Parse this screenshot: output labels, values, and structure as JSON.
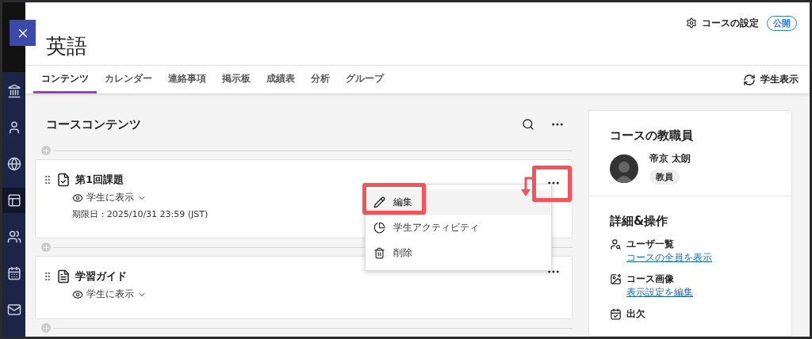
{
  "sidebar": {
    "items": [
      {
        "kind": "institution",
        "selected": false
      },
      {
        "kind": "profile",
        "selected": false
      },
      {
        "kind": "globe",
        "selected": false
      },
      {
        "kind": "courses",
        "selected": true
      },
      {
        "kind": "groups",
        "selected": false
      },
      {
        "kind": "calendar",
        "selected": false
      },
      {
        "kind": "messages",
        "selected": false
      }
    ]
  },
  "course": {
    "title": "英語",
    "settings": "コースの設定",
    "status_badge": "公開"
  },
  "tabs": [
    {
      "label": "コンテンツ",
      "selected": true
    },
    {
      "label": "カレンダー",
      "selected": false
    },
    {
      "label": "連絡事項",
      "selected": false
    },
    {
      "label": "掲示板",
      "selected": false
    },
    {
      "label": "成績表",
      "selected": false
    },
    {
      "label": "分析",
      "selected": false
    },
    {
      "label": "グループ",
      "selected": false
    }
  ],
  "student_view": "学生表示",
  "content": {
    "heading": "コースコンテンツ",
    "items": [
      {
        "kind": "assignment",
        "title": "第1回課題",
        "visibility": "学生に表示",
        "due": "期限日 : 2025/10/31 23:59 (JST)",
        "menu_open": true
      },
      {
        "kind": "document",
        "title": "学習ガイド",
        "visibility": "学生に表示",
        "menu_open": false
      }
    ]
  },
  "context_menu": {
    "items": [
      {
        "kind": "edit",
        "label": "編集",
        "highlighted": true
      },
      {
        "kind": "activity",
        "label": "学生アクティビティ",
        "highlighted": false
      },
      {
        "kind": "delete",
        "label": "削除",
        "highlighted": false
      }
    ]
  },
  "instructors": {
    "heading": "コースの教職員",
    "people": [
      {
        "name": "帝京 太朗",
        "role": "教員"
      }
    ]
  },
  "details": {
    "heading": "詳細&操作",
    "items": [
      {
        "kind": "roster",
        "title": "ユーザ一覧",
        "link": "コースの全員を表示"
      },
      {
        "kind": "image",
        "title": "コース画像",
        "link": "表示設定を編集"
      },
      {
        "kind": "attendance",
        "title": "出欠"
      }
    ]
  }
}
